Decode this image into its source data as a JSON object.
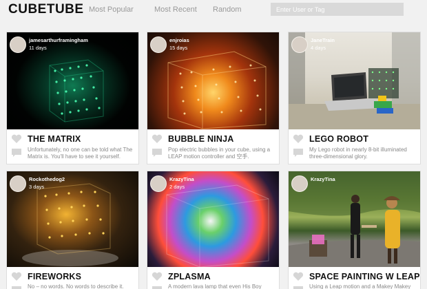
{
  "header": {
    "logo": "CUBETUBE",
    "nav": [
      "Most Popular",
      "Most Recent",
      "Random"
    ],
    "search_placeholder": "Enter User or Tag"
  },
  "cards": [
    {
      "user": "jamesarthurframingham",
      "ago": "11 days",
      "title": "THE MATRIX",
      "desc": "Unfortunately, no one can be told what The Matrix is. You'll have to see it yourself."
    },
    {
      "user": "enjroias",
      "ago": "15 days",
      "title": "BUBBLE NINJA",
      "desc": "Pop electric bubbles in your cube, using a LEAP motion controller and 空手."
    },
    {
      "user": "JaneTrain",
      "ago": "4 days",
      "title": "LEGO ROBOT",
      "desc": "My Lego robot in nearly 8-bit illuminated three-dimensional glory."
    },
    {
      "user": "Rockothedog2",
      "ago": "3 days",
      "title": "FIREWORKS",
      "desc": "No – no words. No words to describe it."
    },
    {
      "user": "KrazyTina",
      "ago": "2 days",
      "title": "ZPLASMA",
      "desc": "A modern lava lamp that even His Boy"
    },
    {
      "user": "KrazyTina",
      "ago": "",
      "title": "SPACE PAINTING W LEAP",
      "desc": "Using a Leap motion and a Makey Makey"
    }
  ]
}
